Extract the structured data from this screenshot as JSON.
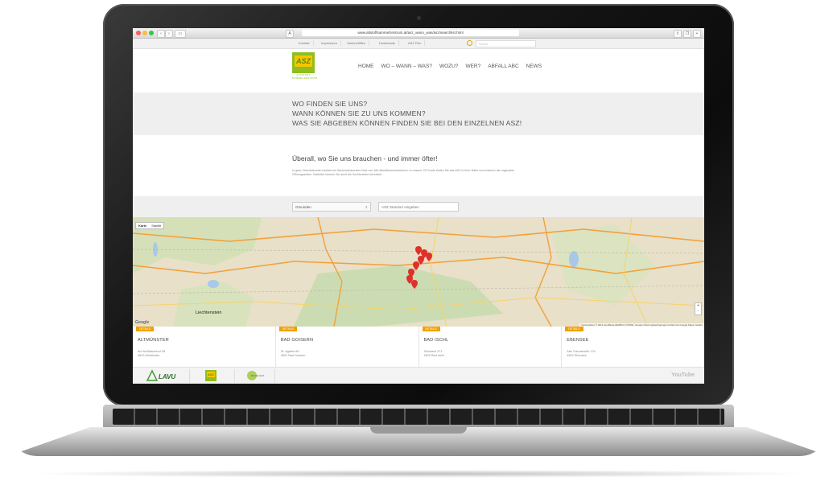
{
  "browser": {
    "url": "www.altstoffsammelzentrum.at/asz_wann_was/asz/searchlist.html",
    "search_placeholder": "Suche"
  },
  "topbar": {
    "links": [
      "Kontakt",
      "Impressum",
      "Sammeltiflen",
      "Downloads",
      "ASZ Film"
    ]
  },
  "logo": {
    "text": "ASZ",
    "sub": "ALTSTOFF SAMMELZENTRUM"
  },
  "nav": [
    "HOME",
    "WO – WANN – WAS?",
    "WOZU?",
    "WER?",
    "ABFALL ABC",
    "NEWS"
  ],
  "headings": [
    "WO FINDEN SIE UNS?",
    "WANN KÖNNEN SIE ZU UNS KOMMEN?",
    "WAS SIE ABGEBEN KÖNNEN FINDEN SIE BEI DEN EINZELNEN ASZ!"
  ],
  "intro": {
    "title": "Überall, wo Sie uns brauchen - und immer öfter!",
    "text": "In ganz Oberösterreich besteht ein flächendeckendes Netz von 184 Altstoffsammelzentren. In unserer OÖ Karte finden Sie das ASZ in Ihrer Nähe und erfahren die regionalen Öffnungszeiten. Natürlich können Sie auch die Suchfunktion benutzen."
  },
  "filters": {
    "district": "Gmunden",
    "standort_placeholder": "ASZ Standort eingeben"
  },
  "map": {
    "toggle": [
      "Karte",
      "Satellit"
    ],
    "label": "Liechtenstein",
    "attribution": "Kartendaten © 2014 GeoBasis-DE/BKG (©2009), Google   Nutzungsbedingungen   Fehler bei Google Maps melden",
    "google": "Google",
    "zoom_in": "+",
    "zoom_out": "-"
  },
  "locations": [
    {
      "tag": "DETAILS",
      "name": "ALTMÜNSTER",
      "street": "Am Nußbaumhof 28",
      "city": "4813 Altmünster"
    },
    {
      "tag": "DETAILS",
      "name": "BAD GOISERN",
      "street": "St. Agatha 80",
      "city": "4822 Bad Goisern"
    },
    {
      "tag": "DETAILS",
      "name": "BAD ISCHL",
      "street": "Sulzbach 271",
      "city": "4820 Bad Ischl"
    },
    {
      "tag": "DETAILS",
      "name": "EBENSEE",
      "street": "Alte Traunstraße 17b",
      "city": "4802 Ebensee"
    }
  ],
  "footer": {
    "logos": [
      "LAVU",
      "ASZ",
      "Oberösterreich"
    ],
    "youtube": "YouTube"
  },
  "colors": {
    "accent": "#f0a000",
    "logo_green": "#8fbe1e",
    "logo_yellow": "#f6c700"
  }
}
